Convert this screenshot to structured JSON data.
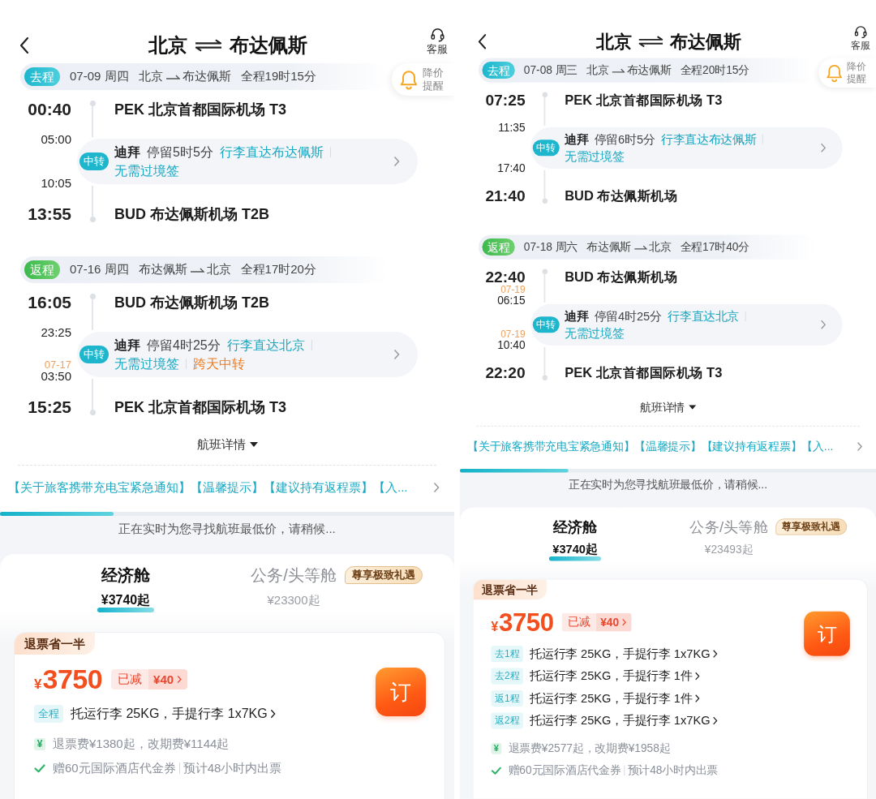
{
  "screens": [
    {
      "header": {
        "origin": "北京",
        "destination": "布达佩斯",
        "service_label": "客服"
      },
      "price_alert": {
        "label": "降价提醒"
      },
      "legs": [
        {
          "kind": "outbound",
          "tag": "去程",
          "date": "07-09 周四",
          "origin": "北京",
          "destination": "布达佩斯",
          "duration": "全程19时15分",
          "departure": {
            "time": "00:40",
            "airport": "PEK 北京首都国际机场 T3"
          },
          "transfer": {
            "arrive_time": "05:00",
            "depart_time": "10:05",
            "badge": "中转",
            "city": "迪拜",
            "stay": "停留5时5分",
            "notes": [
              {
                "kind": "info",
                "text": "行李直达布达佩斯"
              },
              {
                "kind": "info",
                "text": "无需过境签"
              }
            ]
          },
          "arrival": {
            "time": "13:55",
            "airport": "BUD 布达佩斯机场 T2B"
          }
        },
        {
          "kind": "return",
          "tag": "返程",
          "date": "07-16 周四",
          "origin": "布达佩斯",
          "destination": "北京",
          "duration": "全程17时20分",
          "departure": {
            "time": "16:05",
            "airport": "BUD 布达佩斯机场 T2B"
          },
          "transfer": {
            "arrive_time": "23:25",
            "depart_date": "07-17",
            "depart_time": "03:50",
            "badge": "中转",
            "city": "迪拜",
            "stay": "停留4时25分",
            "notes": [
              {
                "kind": "info",
                "text": "行李直达北京"
              },
              {
                "kind": "info",
                "text": "无需过境签"
              },
              {
                "kind": "warning",
                "text": "跨天中转"
              }
            ]
          },
          "arrival": {
            "time": "15:25",
            "airport": "PEK 北京首都国际机场 T3"
          }
        }
      ],
      "details_link": "航班详情",
      "notice": "【关于旅客携带充电宝紧急通知】【温馨提示】【建议持有返程票】【入...",
      "loading": {
        "level": 0.25,
        "text": "正在实时为您寻找航班最低价，请稍候..."
      },
      "cabin_tabs": [
        {
          "label": "经济舱",
          "price": "¥3740起",
          "selected": true
        },
        {
          "label": "公务/头等舱",
          "badge": "尊享极致礼遇",
          "price": "¥23300起",
          "selected": false
        }
      ],
      "fare": {
        "tag": "退票省一半",
        "currency": "¥",
        "price": "3750",
        "discount": {
          "label": "已减",
          "amount": "¥40"
        },
        "baggage": [
          {
            "segment": "全程",
            "text": "托运行李 25KG，手提行李 1x7KG"
          }
        ],
        "fee_icon": "¥",
        "fees": "退票费¥1380起，改期费¥1144起",
        "perks": [
          "赠60元国际酒店代金券",
          "预计48小时内出票"
        ],
        "book_label": "订"
      }
    },
    {
      "header": {
        "origin": "北京",
        "destination": "布达佩斯",
        "service_label": "客服"
      },
      "price_alert": {
        "label": "降价提醒"
      },
      "legs": [
        {
          "kind": "outbound",
          "tag": "去程",
          "date": "07-08 周三",
          "origin": "北京",
          "destination": "布达佩斯",
          "duration": "全程20时15分",
          "departure": {
            "time": "07:25",
            "airport": "PEK 北京首都国际机场 T3"
          },
          "transfer": {
            "arrive_time": "11:35",
            "depart_time": "17:40",
            "badge": "中转",
            "city": "迪拜",
            "stay": "停留6时5分",
            "notes": [
              {
                "kind": "info",
                "text": "行李直达布达佩斯"
              },
              {
                "kind": "info",
                "text": "无需过境签"
              }
            ]
          },
          "arrival": {
            "time": "21:40",
            "airport": "BUD 布达佩斯机场"
          }
        },
        {
          "kind": "return",
          "tag": "返程",
          "date": "07-18 周六",
          "origin": "布达佩斯",
          "destination": "北京",
          "duration": "全程17时40分",
          "departure": {
            "time": "22:40",
            "airport": "BUD 布达佩斯机场"
          },
          "transfer": {
            "arrive_date": "07-19",
            "arrive_time": "06:15",
            "depart_date": "07-19",
            "depart_time": "10:40",
            "badge": "中转",
            "city": "迪拜",
            "stay": "停留4时25分",
            "notes": [
              {
                "kind": "info",
                "text": "行李直达北京"
              },
              {
                "kind": "info",
                "text": "无需过境签"
              }
            ]
          },
          "arrival": {
            "time": "22:20",
            "airport": "PEK 北京首都国际机场 T3"
          }
        }
      ],
      "details_link": "航班详情",
      "notice": "【关于旅客携带充电宝紧急通知】【温馨提示】【建议持有返程票】【入...",
      "loading": {
        "level": 0.26,
        "text": "正在实时为您寻找航班最低价，请稍候..."
      },
      "cabin_tabs": [
        {
          "label": "经济舱",
          "price": "¥3740起",
          "selected": true
        },
        {
          "label": "公务/头等舱",
          "badge": "尊享极致礼遇",
          "price": "¥23493起",
          "selected": false
        }
      ],
      "fare": {
        "tag": "退票省一半",
        "currency": "¥",
        "price": "3750",
        "discount": {
          "label": "已减",
          "amount": "¥40"
        },
        "baggage": [
          {
            "segment": "去1程",
            "text": "托运行李 25KG，手提行李 1x7KG"
          },
          {
            "segment": "去2程",
            "text": "托运行李 25KG，手提行李 1件"
          },
          {
            "segment": "返1程",
            "text": "托运行李 25KG，手提行李 1件"
          },
          {
            "segment": "返2程",
            "text": "托运行李 25KG，手提行李 1x7KG"
          }
        ],
        "fee_icon": "¥",
        "fees": "退票费¥2577起，改期费¥1958起",
        "perks": [
          "赠60元国际酒店代金券",
          "预计48小时内出票"
        ],
        "book_label": "订"
      }
    }
  ]
}
